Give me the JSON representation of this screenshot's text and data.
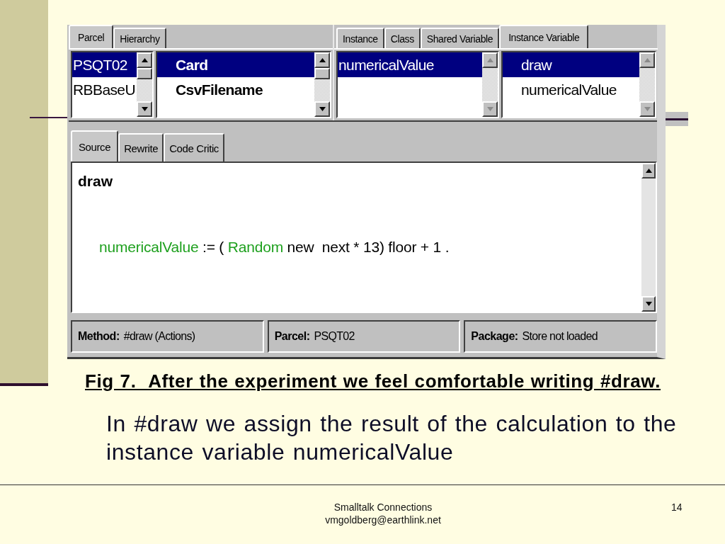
{
  "browser": {
    "top_left": {
      "tabs": [
        {
          "label": "Parcel",
          "selected": true
        },
        {
          "label": "Hierarchy",
          "selected": false
        }
      ],
      "lists": [
        {
          "kind": "parcels",
          "scrollbar_enabled": true,
          "items": [
            {
              "text": "PSQT02",
              "selected": true
            },
            {
              "text": "RBBaseU",
              "selected": false
            }
          ]
        },
        {
          "kind": "classes",
          "scrollbar_enabled": true,
          "items": [
            {
              "text": "Card",
              "selected": true
            },
            {
              "text": "CsvFilename",
              "selected": false
            }
          ]
        }
      ]
    },
    "top_right": {
      "tabs": [
        {
          "label": "Instance",
          "selected": false
        },
        {
          "label": "Class",
          "selected": false
        },
        {
          "label": "Shared Variable",
          "selected": false
        },
        {
          "label": "Instance Variable",
          "selected": true
        }
      ],
      "lists": [
        {
          "kind": "variables",
          "scrollbar_enabled": false,
          "items": [
            {
              "text": "numericalValue",
              "selected": true
            }
          ]
        },
        {
          "kind": "methods",
          "scrollbar_enabled": false,
          "items": [
            {
              "text": "draw",
              "selected": true
            },
            {
              "text": "numericalValue",
              "selected": false
            }
          ]
        }
      ]
    },
    "editor_tabs": [
      {
        "label": "Source",
        "selected": true
      },
      {
        "label": "Rewrite",
        "selected": false
      },
      {
        "label": "Code Critic",
        "selected": false
      }
    ],
    "source": {
      "lines": [
        {
          "kind": "selector",
          "segments": [
            {
              "kind": "text",
              "text": "draw"
            }
          ]
        },
        {
          "kind": "statement",
          "segments": [
            {
              "kind": "identifier",
              "text": "numericalValue"
            },
            {
              "kind": "text",
              "text": " := ( "
            },
            {
              "kind": "identifier",
              "text": "Random"
            },
            {
              "kind": "text",
              "text": " new  next * 13) floor + 1 ."
            }
          ]
        }
      ]
    },
    "status_bar": [
      {
        "label": "Method:",
        "value": "#draw (Actions)"
      },
      {
        "label": "Parcel:",
        "value": "PSQT02"
      },
      {
        "label": "Package:",
        "value": "Store not loaded"
      }
    ]
  },
  "caption": "Fig 7.  After the experiment we feel comfortable writing #draw.",
  "body": "In #draw we assign the result of the calculation to the instance variable numericalValue",
  "footer": {
    "lines": [
      "Smalltalk Connections",
      "vmgoldberg@earthlink.net"
    ],
    "page_number": "14"
  }
}
